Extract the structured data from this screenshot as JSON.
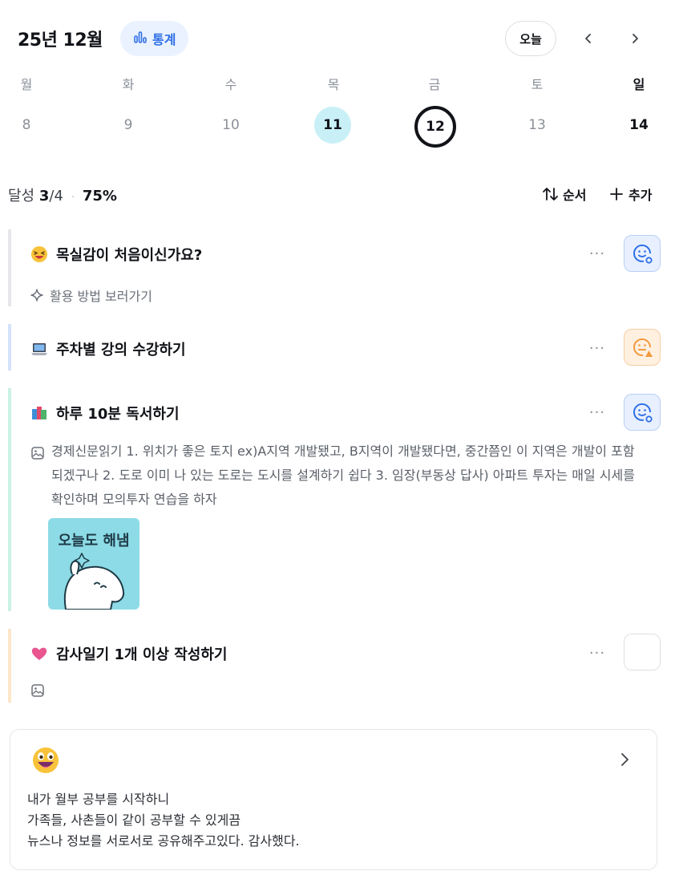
{
  "header": {
    "month_title": "25년 12월",
    "stats_label": "통계",
    "today_label": "오늘"
  },
  "week": {
    "weekdays": [
      "월",
      "화",
      "수",
      "목",
      "금",
      "토",
      "일"
    ],
    "days": [
      "8",
      "9",
      "10",
      "11",
      "12",
      "13",
      "14"
    ],
    "completed_day": "11",
    "selected_day": "12"
  },
  "summary": {
    "label": "달성",
    "done": "3",
    "total": "/4",
    "separator": "·",
    "percent": "75%",
    "sort_label": "순서",
    "add_label": "추가"
  },
  "habits": [
    {
      "title": "목실감이 처음이신가요?",
      "emoji": "laughing-face",
      "status": "done",
      "subline": "활용 방법 보러가기",
      "accent": "#e6e7ea"
    },
    {
      "title": "주차별 강의 수강하기",
      "emoji": "laptop",
      "status": "warning",
      "accent": "#d4e2fb"
    },
    {
      "title": "하루 10분 독서하기",
      "emoji": "books",
      "status": "done",
      "memo": "경제신문읽기 1. 위치가 좋은 토지 ex)A지역 개발됐고, B지역이 개발됐다면, 중간쯤인 이 지역은 개발이 포함되겠구나 2. 도로 이미 나 있는 도로는 도시를 설계하기 쉽다 3. 임장(부동상 답사) 아파트 투자는 매일 시세를 확인하며 모의투자 연습을 하자",
      "sticker_text": "오늘도 해냄",
      "accent": "#c9f1e6"
    },
    {
      "title": "감사일기 1개 이상 작성하기",
      "emoji": "pink-heart",
      "status": "empty",
      "accent": "#fde6c9"
    }
  ],
  "diary": {
    "emoji": "grinning-face",
    "lines": [
      "내가 월부 공부를 시작하니",
      "가족들, 사촌들이 같이 공부할 수 있게끔",
      "뉴스나 정보를 서로서로 공유해주고있다. 감사했다."
    ]
  },
  "colors": {
    "accent_blue": "#2f6fe6",
    "completed_day_bg": "#c9f0f7",
    "done_check_bg": "#e8f0ff",
    "warning_check_bg": "#fff0e0",
    "warning_orange": "#f19a3e"
  }
}
